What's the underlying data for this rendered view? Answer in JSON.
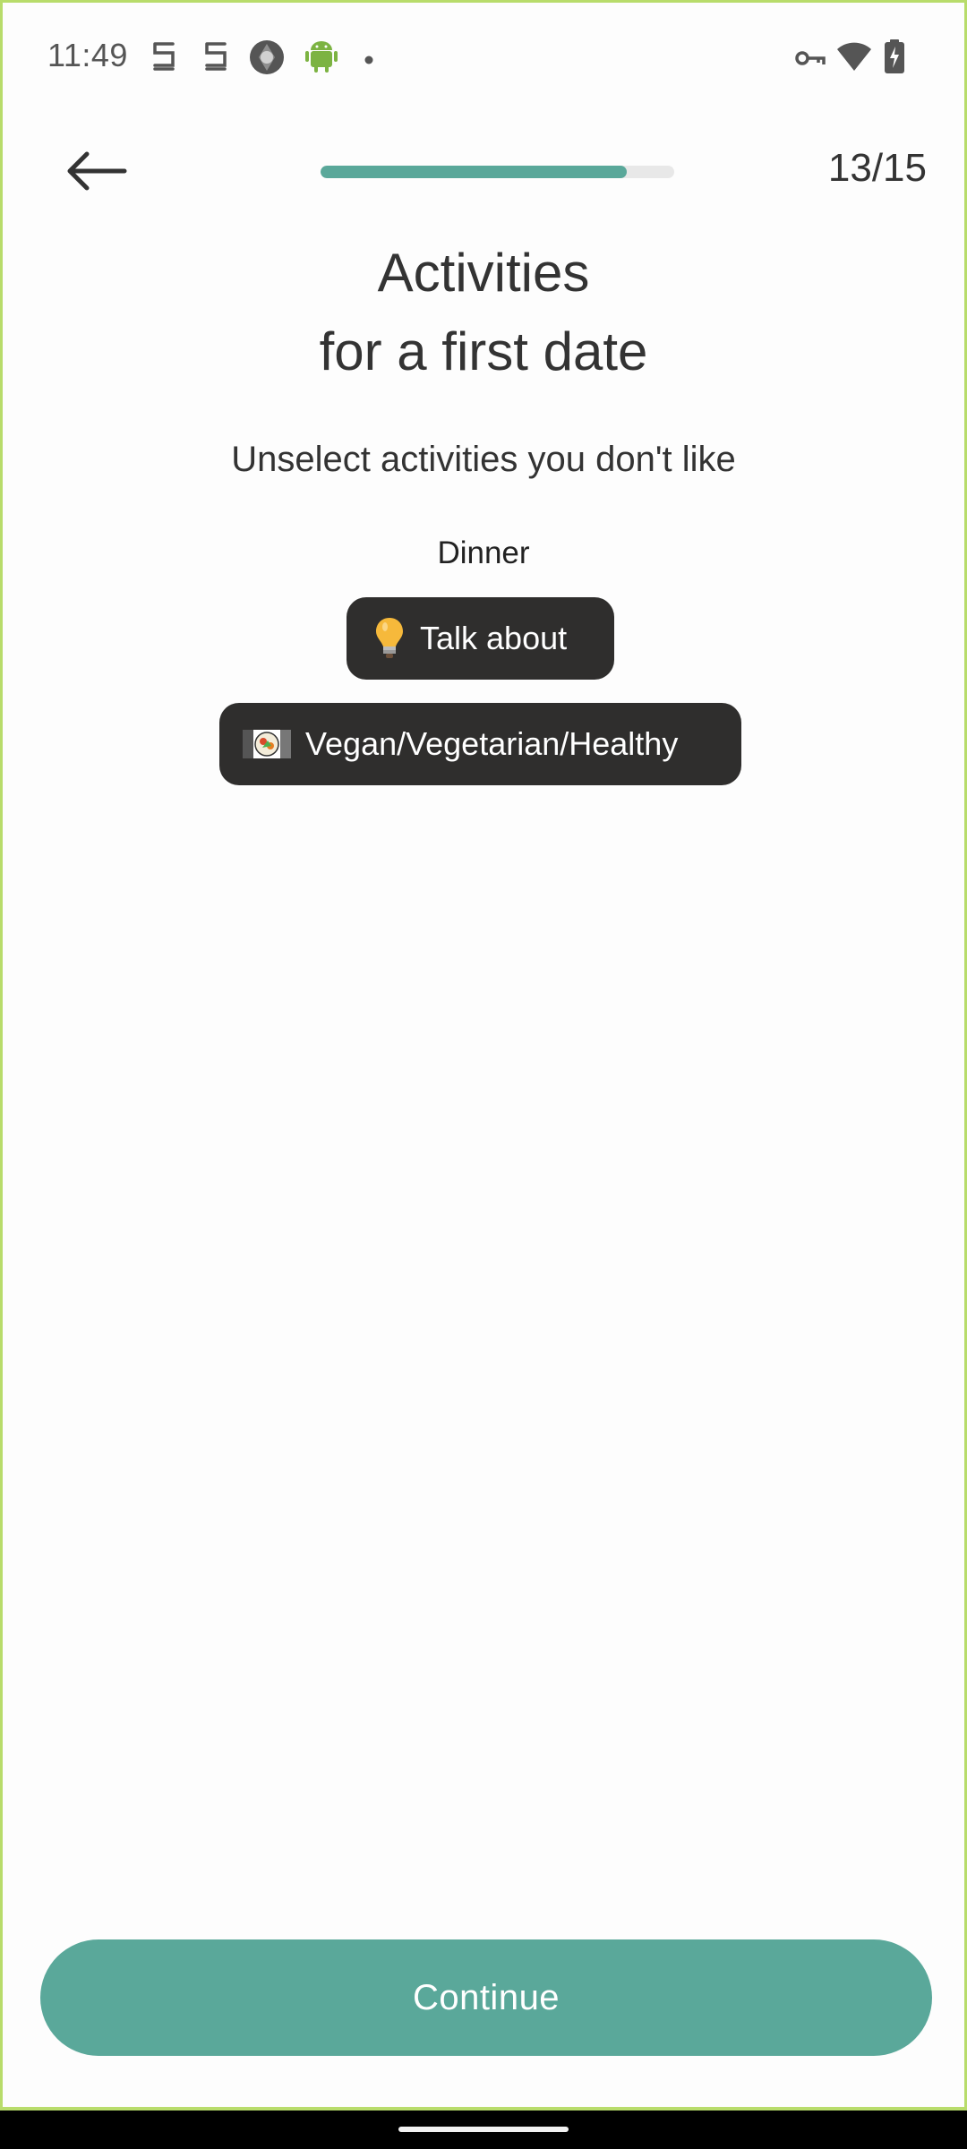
{
  "status_bar": {
    "time": "11:49",
    "icons_left": [
      "notification-s-icon",
      "notification-s-icon",
      "camera-shutter-icon",
      "android-icon",
      "dot-icon"
    ],
    "icons_right": [
      "vpn-key-icon",
      "wifi-icon",
      "battery-charging-icon"
    ]
  },
  "header": {
    "progress_fraction": 0.867,
    "step_counter": "13/15"
  },
  "page": {
    "title_line1": "Activities",
    "title_line2": "for a first date",
    "subtitle": "Unselect activities you don't like",
    "section_label": "Dinner"
  },
  "chips": [
    {
      "icon": "lightbulb-icon",
      "label": "Talk about"
    },
    {
      "icon": "vegan-food-icon",
      "label": "Vegan/Vegetarian/Healthy"
    }
  ],
  "footer": {
    "continue_label": "Continue"
  },
  "colors": {
    "accent": "#5aa89a",
    "chip_bg": "#2f2e2d",
    "frame_border": "#b8dc6b"
  }
}
